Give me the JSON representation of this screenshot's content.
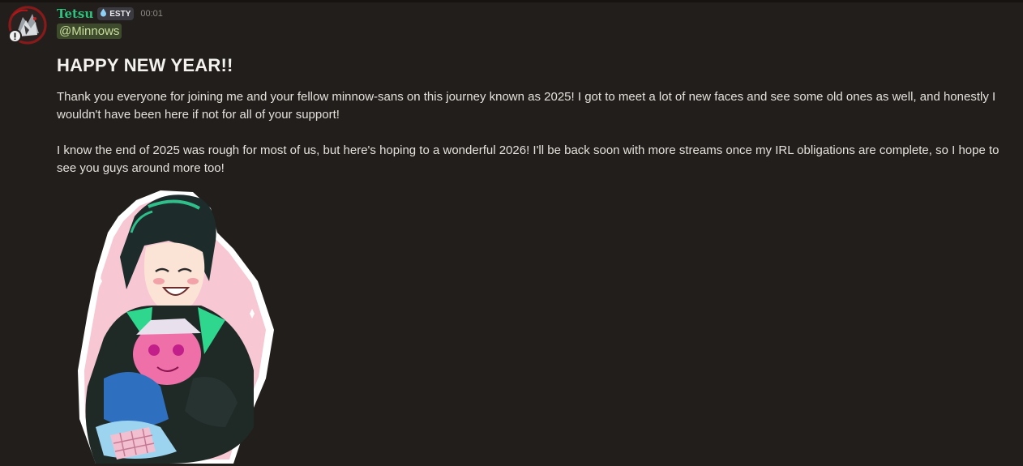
{
  "message": {
    "author": "Tetsu",
    "tag": {
      "icon": "water-drop-icon",
      "label": "ESTY"
    },
    "timestamp": "00:01",
    "mention": "@Minnows",
    "heading": "HAPPY NEW YEAR!!",
    "paragraphs": [
      "Thank you everyone for joining me and your fellow minnow-sans on this journey known as 2025! I got to meet a lot of new faces and see some old ones as well, and honestly I wouldn't have been here if not for all of your support!",
      "I know the end of 2025 was rough for most of us, but here's hoping to a wonderful 2026! I'll be back soon with more streams once my IRL obligations are complete, so I hope to see you guys around more too!"
    ],
    "attachment": {
      "type": "image",
      "icon": "character-hugging-plush-illustration"
    }
  },
  "colors": {
    "background": "#221e1b",
    "username": "#2ec27e",
    "mention_bg": "#3e4a2c",
    "mention_text": "#c9df9c",
    "timestamp": "#8e8a86"
  }
}
